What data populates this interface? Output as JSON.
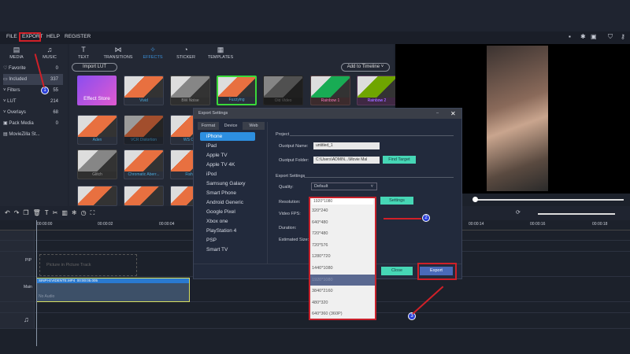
{
  "menu": [
    "FILE",
    "EXPORT",
    "HELP",
    "REGISTER"
  ],
  "nav_tabs": [
    {
      "label": "MEDIA",
      "icon": "media-icon"
    },
    {
      "label": "MUSIC",
      "icon": "music-icon"
    }
  ],
  "categories": [
    {
      "label": "Favorite",
      "count": "0"
    },
    {
      "label": "Included",
      "count": "337"
    },
    {
      "label": "Filters",
      "count": "55"
    },
    {
      "label": "LUT",
      "count": "214"
    },
    {
      "label": "Overlays",
      "count": "68"
    },
    {
      "label": "Pack Media",
      "count": "0"
    },
    {
      "label": "MovieZilla St...",
      "count": ""
    }
  ],
  "effect_tabs": [
    "TEXT",
    "TRANSITIONS",
    "EFFECTS",
    "STICKER",
    "TEMPLATES"
  ],
  "import_lut": "Import LUT",
  "add_to_timeline": "Add to Timeline",
  "effect_store": "Effect Store",
  "effects": [
    "Vivid",
    "BW Noise",
    "Fuzzying",
    "Old Video",
    "Rainbow 1",
    "Rainbow 2",
    "Aden",
    "VCR Distortion",
    "WS Old",
    "Glitch",
    "Chromatic Aberr...",
    "Fishe"
  ],
  "dialog": {
    "title": "Export Settings",
    "tabs": [
      "Format",
      "Device",
      "Web"
    ],
    "devices": [
      "iPhone",
      "iPad",
      "Apple TV",
      "Apple TV 4K",
      "iPod",
      "Samsung Galaxy",
      "Smart Phone",
      "Android Generic",
      "Google Pixel",
      "Xbox one",
      "PlayStation 4",
      "PSP",
      "Smart TV"
    ],
    "project_label": "Project",
    "output_name_label": "Ouotput Name:",
    "output_name": "untitled_1",
    "output_folder_label": "Ouotput Folder:",
    "output_folder": "C:\\Users\\ADMIN...\\Movie Mal",
    "find_target": "Find Target",
    "export_settings_label": "Export Settings",
    "quality_label": "Quality:",
    "quality": "Default",
    "resolution_label": "Resolution:",
    "resolution": "1920*1080",
    "settings": "Settings",
    "fps_label": "Video FPS:",
    "duration_label": "Duration:",
    "size_label": "Estimated Size:",
    "close": "Close",
    "export": "Export",
    "resolution_options": [
      "320*240",
      "640*480",
      "720*480",
      "720*576",
      "1280*720",
      "1440*1080",
      "1920*1080",
      "3840*2160",
      "480*320",
      "640*360 (360P)"
    ]
  },
  "badges": [
    "1",
    "2",
    "3"
  ],
  "ruler": [
    "00:00:00",
    "00:00:02",
    "00:00:04",
    "00:00:14",
    "00:00:16",
    "00:00:18"
  ],
  "tracks": {
    "pip_label": "PIP",
    "pip_placeholder": "Picture in Picture Track",
    "main_label": "Main",
    "clip_name": "SINPI-EVIDENTE.MP4",
    "clip_duration": "00:00:05.005",
    "no_audio": "No Audio"
  }
}
